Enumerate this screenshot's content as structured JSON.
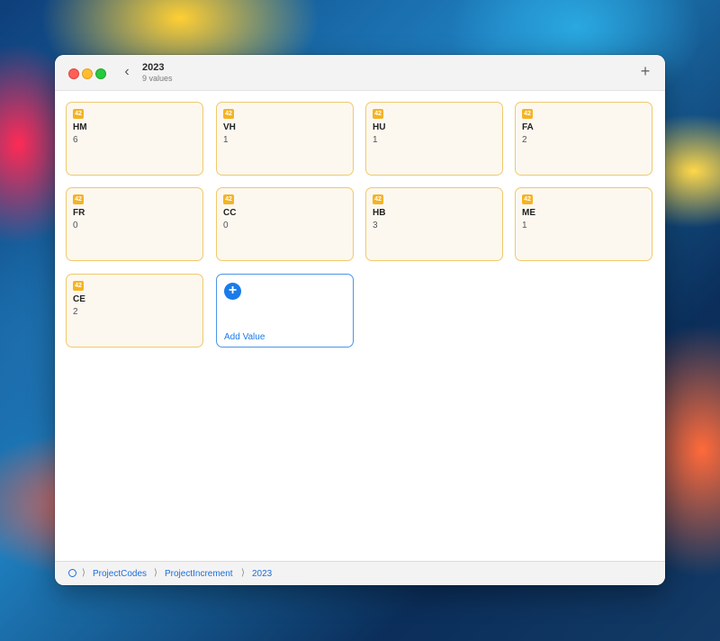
{
  "window": {
    "title": "2023",
    "subtitle": "9 values",
    "back_icon": "chevron-left-icon",
    "add_icon": "plus-icon"
  },
  "cards": [
    {
      "badge": "42",
      "name": "HM",
      "count": "6"
    },
    {
      "badge": "42",
      "name": "VH",
      "count": "1"
    },
    {
      "badge": "42",
      "name": "HU",
      "count": "1"
    },
    {
      "badge": "42",
      "name": "FA",
      "count": "2"
    },
    {
      "badge": "42",
      "name": "FR",
      "count": "0"
    },
    {
      "badge": "42",
      "name": "CC",
      "count": "0"
    },
    {
      "badge": "42",
      "name": "HB",
      "count": "3"
    },
    {
      "badge": "42",
      "name": "ME",
      "count": "1"
    },
    {
      "badge": "42",
      "name": "CE",
      "count": "2"
    }
  ],
  "add_card": {
    "label": "Add Value",
    "icon": "plus-circle-icon"
  },
  "path": {
    "root_icon": "circle-icon",
    "items": [
      "ProjectCodes",
      "ProjectIncrement",
      "2023"
    ]
  },
  "colors": {
    "accent": "#1a7bea",
    "card_border": "#f0c96a",
    "card_background": "#fcf8f0",
    "badge": "#f5b324"
  }
}
